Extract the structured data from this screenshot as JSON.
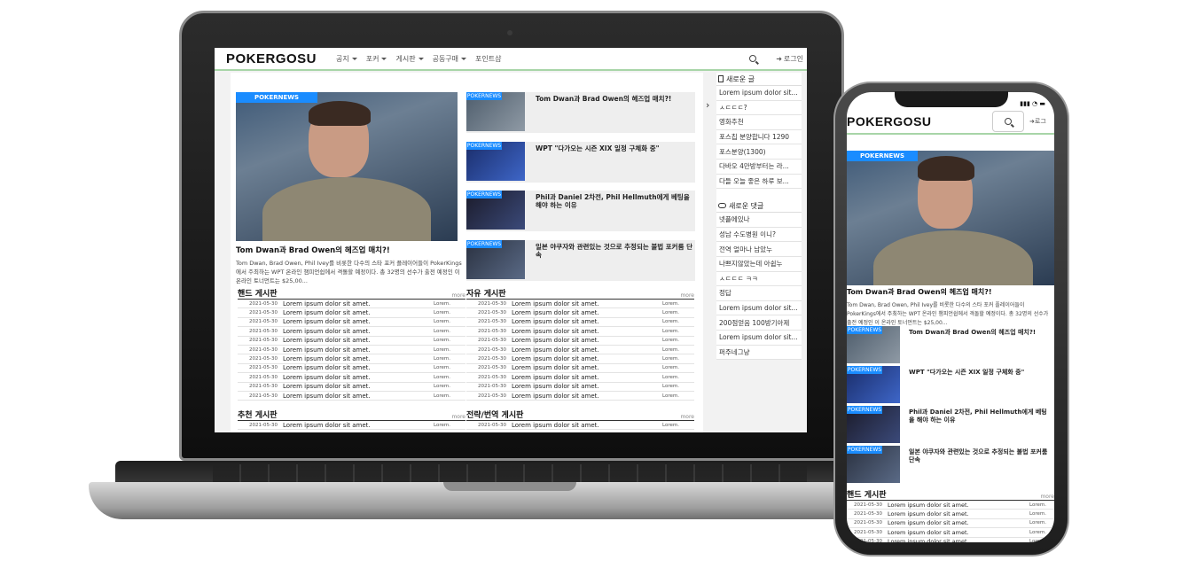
{
  "site": {
    "logo": "POKERGOSU",
    "nav": [
      {
        "label": "공지",
        "dropdown": true
      },
      {
        "label": "포커",
        "dropdown": true
      },
      {
        "label": "게시판",
        "dropdown": true
      },
      {
        "label": "공동구매",
        "dropdown": true
      },
      {
        "label": "포인트샵",
        "dropdown": false
      }
    ],
    "login_label": "로그인",
    "login_label_mobile": "로그",
    "login_icon": "login-arrow-icon",
    "search_icon": "search-icon",
    "accent_color": "#1a8cff",
    "header_border_color": "#a8d5a8"
  },
  "featured": {
    "badge": "POKERNEWS",
    "title": "Tom Dwan과 Brad Owen의 헤즈업 매치?!",
    "description": "Tom Dwan, Brad Owen, Phil Ivey를 비롯한 다수의 스타 포커 플레이어들이 PokerKings에서 주최하는 WPT 온라인 챔피언쉽에서 격돌할 예정이다. 총 32명의 선수가 출전 예정인 이 온라인 토너먼트는 $25,00...",
    "description_mobile": "Tom Dwan, Brad Owen, Phil Ivey를 비롯한 다수의 스타 포커 플레이어들이 PokerKings에서 주최하는 WPT 온라인 챔피언쉽에서 격돌할 예정이다. 총 32명의 선수가 출전 예정인 이 온라인 토너먼트는 $25,00..."
  },
  "side_news": [
    {
      "badge": "POKERNEWS",
      "title": "Tom Dwan과 Brad Owen의 헤즈업 매치?!"
    },
    {
      "badge": "POKERNEWS",
      "title": "WPT \"다가오는 시즌 XIX 일정 구체화 중\""
    },
    {
      "badge": "POKERNEWS",
      "title": "Phil과 Daniel 2차전, Phil Hellmuth에게 베팅을 해야 하는 이유"
    },
    {
      "badge": "POKERNEWS",
      "title": "일본 야쿠자와 관련있는 것으로 추정되는 불법 포커룸 단속"
    }
  ],
  "boards": {
    "hand": {
      "title": "핸드 게시판",
      "more": "more",
      "rows": [
        {
          "date": "2021-05-30",
          "title": "Lorem ipsum dolor sit amet.",
          "author": "Lorem."
        },
        {
          "date": "2021-05-30",
          "title": "Lorem ipsum dolor sit amet.",
          "author": "Lorem."
        },
        {
          "date": "2021-05-30",
          "title": "Lorem ipsum dolor sit amet.",
          "author": "Lorem."
        },
        {
          "date": "2021-05-30",
          "title": "Lorem ipsum dolor sit amet.",
          "author": "Lorem."
        },
        {
          "date": "2021-05-30",
          "title": "Lorem ipsum dolor sit amet.",
          "author": "Lorem."
        },
        {
          "date": "2021-05-30",
          "title": "Lorem ipsum dolor sit amet.",
          "author": "Lorem."
        },
        {
          "date": "2021-05-30",
          "title": "Lorem ipsum dolor sit amet.",
          "author": "Lorem."
        },
        {
          "date": "2021-05-30",
          "title": "Lorem ipsum dolor sit amet.",
          "author": "Lorem."
        },
        {
          "date": "2021-05-30",
          "title": "Lorem ipsum dolor sit amet.",
          "author": "Lorem."
        },
        {
          "date": "2021-05-30",
          "title": "Lorem ipsum dolor sit amet.",
          "author": "Lorem."
        },
        {
          "date": "2021-05-30",
          "title": "Lorem ipsum dolor sit amet.",
          "author": "Lorem."
        }
      ]
    },
    "free": {
      "title": "자유 게시판",
      "more": "more",
      "rows": [
        {
          "date": "2021-05-30",
          "title": "Lorem ipsum dolor sit amet.",
          "author": "Lorem."
        },
        {
          "date": "2021-05-30",
          "title": "Lorem ipsum dolor sit amet.",
          "author": "Lorem."
        },
        {
          "date": "2021-05-30",
          "title": "Lorem ipsum dolor sit amet.",
          "author": "Lorem."
        },
        {
          "date": "2021-05-30",
          "title": "Lorem ipsum dolor sit amet.",
          "author": "Lorem."
        },
        {
          "date": "2021-05-30",
          "title": "Lorem ipsum dolor sit amet.",
          "author": "Lorem."
        },
        {
          "date": "2021-05-30",
          "title": "Lorem ipsum dolor sit amet.",
          "author": "Lorem."
        },
        {
          "date": "2021-05-30",
          "title": "Lorem ipsum dolor sit amet.",
          "author": "Lorem."
        },
        {
          "date": "2021-05-30",
          "title": "Lorem ipsum dolor sit amet.",
          "author": "Lorem."
        },
        {
          "date": "2021-05-30",
          "title": "Lorem ipsum dolor sit amet.",
          "author": "Lorem."
        },
        {
          "date": "2021-05-30",
          "title": "Lorem ipsum dolor sit amet.",
          "author": "Lorem."
        },
        {
          "date": "2021-05-30",
          "title": "Lorem ipsum dolor sit amet.",
          "author": "Lorem."
        }
      ]
    },
    "recommend": {
      "title": "추천 게시판",
      "more": "more",
      "rows": [
        {
          "date": "2021-05-30",
          "title": "Lorem ipsum dolor sit amet.",
          "author": "Lorem."
        }
      ]
    },
    "strategy": {
      "title": "전략/번역 게시판",
      "more": "more",
      "rows": [
        {
          "date": "2021-05-30",
          "title": "Lorem ipsum dolor sit amet.",
          "author": "Lorem."
        }
      ]
    },
    "hand_mobile": {
      "title": "핸드 게시판",
      "more": "more",
      "rows": [
        {
          "date": "2021-05-30",
          "title": "Lorem ipsum dolor sit amet.",
          "author": "Lorem."
        },
        {
          "date": "2021-05-30",
          "title": "Lorem ipsum dolor sit amet.",
          "author": "Lorem."
        },
        {
          "date": "2021-05-30",
          "title": "Lorem ipsum dolor sit amet.",
          "author": "Lorem."
        },
        {
          "date": "2021-05-30",
          "title": "Lorem ipsum dolor sit amet.",
          "author": "Lorem."
        },
        {
          "date": "2021-05-30",
          "title": "Lorem ipsum dolor sit amet.",
          "author": "Lorem."
        }
      ]
    }
  },
  "new_posts": {
    "title": "새로운 글",
    "items": [
      "Lorem ipsum dolor sit...",
      "ㅅㄷㄷㄷ?",
      "영화추천",
      "포스칩 분양합니다 1290",
      "포스분양(1300)",
      "다바오 4만방부터는 라...",
      "다들 오늘 좋은 하루 보..."
    ]
  },
  "new_comments": {
    "title": "새로운 댓글",
    "items": [
      "넷플에있나",
      "성남 수도병원 이니?",
      "전역 얼마나 남았누",
      "나쁘지않았는데 아쉽누",
      "ㅅㄷㄷㄷ ㅋㅋ",
      "정답",
      "Lorem ipsum dolor sit...",
      "200점얻음 100방기아제",
      "Lorem ipsum dolor sit...",
      "퍼주네그냥"
    ]
  },
  "phone_status": "▮▮▮ ◔ ▬"
}
